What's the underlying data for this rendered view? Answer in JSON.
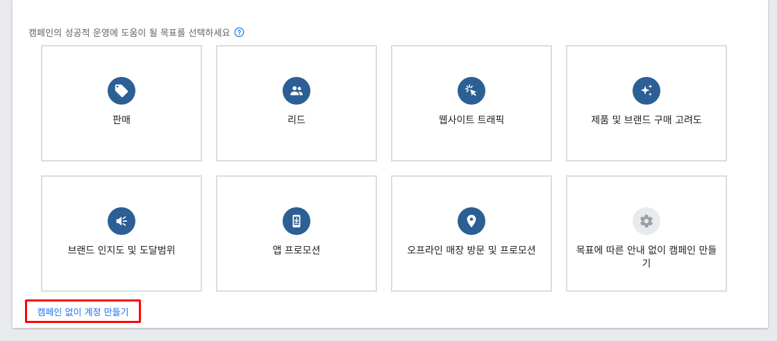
{
  "prompt": {
    "text": "캠페인의 성공적 운영에 도움이 될 목표를 선택하세요",
    "help_icon": "help-circle-icon"
  },
  "goals": [
    {
      "label": "판매",
      "icon": "tag-icon"
    },
    {
      "label": "리드",
      "icon": "people-icon"
    },
    {
      "label": "웹사이트 트래픽",
      "icon": "cursor-click-icon"
    },
    {
      "label": "제품 및 브랜드 구매 고려도",
      "icon": "sparkle-icon"
    },
    {
      "label": "브랜드 인지도 및 도달범위",
      "icon": "speaker-icon"
    },
    {
      "label": "앱 프로모션",
      "icon": "phone-download-icon"
    },
    {
      "label": "오프라인 매장 방문 및 프로모션",
      "icon": "location-pin-icon"
    },
    {
      "label": "목표에 따른 안내 없이 캠페인 만들기",
      "icon": "gear-icon"
    }
  ],
  "footer_link": {
    "label": "캠페인 없이 계정 만들기"
  },
  "colors": {
    "icon_bg": "#2c5f94",
    "icon_bg_neutral": "#e8eaed",
    "link": "#1a73e8",
    "highlight": "#ff0000"
  }
}
